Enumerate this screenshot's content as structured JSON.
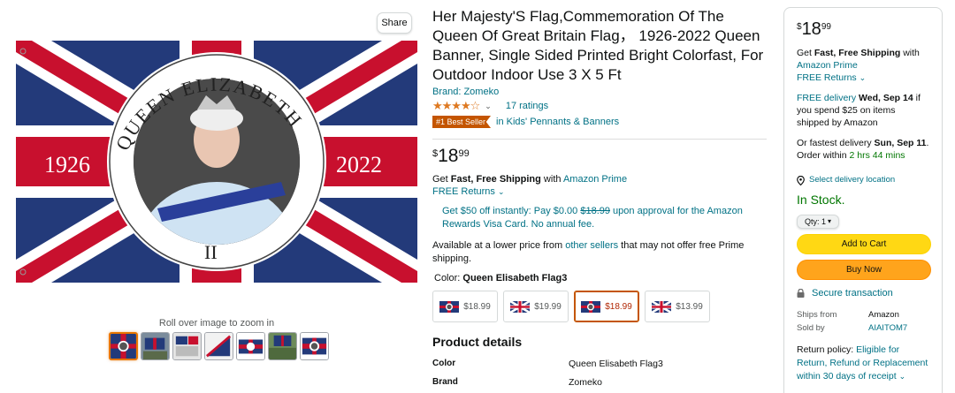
{
  "gallery": {
    "share_label": "Share",
    "zoom_hint": "Roll over image to zoom in",
    "flag_text": {
      "left_year": "1926",
      "right_year": "2022",
      "ring_top": "QUEEN ELIZABETH",
      "ring_bottom": "II"
    },
    "thumbnail_count": 7
  },
  "product": {
    "title": "Her Majesty'S Flag,Commemoration Of The Queen Of Great Britain Flag， 1926-2022 Queen Banner, Single Sided Printed Bright Colorfast, For Outdoor Indoor Use 3 X 5 Ft",
    "brand": "Brand: Zomeko",
    "stars": "★★★★☆",
    "rating_count": "17 ratings",
    "best_seller_badge": "#1 Best Seller",
    "best_seller_category": "in Kids' Pennants & Banners",
    "price": {
      "symbol": "$",
      "whole": "18",
      "fraction": "99"
    },
    "shipping_prefix": "Get ",
    "shipping_bold": "Fast, Free Shipping",
    "shipping_mid": " with ",
    "shipping_link": "Amazon Prime",
    "free_returns": "FREE Returns",
    "promo_pre": "Get $50 off instantly: Pay $0.00 ",
    "promo_strike": "$18.99",
    "promo_post": " upon approval for the Amazon Rewards Visa Card. No annual fee.",
    "lower_price_pre": "Available at a lower price from ",
    "lower_price_link": "other sellers",
    "lower_price_post": " that may not offer free Prime shipping.",
    "color_label": "Color: ",
    "color_value": "Queen Elisabeth Flag3",
    "swatches": [
      {
        "price": "$18.99"
      },
      {
        "price": "$19.99"
      },
      {
        "price": "$18.99"
      },
      {
        "price": "$13.99"
      }
    ],
    "details_title": "Product details",
    "details": [
      {
        "key": "Color",
        "value": "Queen Elisabeth Flag3"
      },
      {
        "key": "Brand",
        "value": "Zomeko"
      }
    ]
  },
  "buybox": {
    "price": {
      "symbol": "$",
      "whole": "18",
      "fraction": "99"
    },
    "shipping_prefix": "Get ",
    "shipping_bold": "Fast, Free Shipping",
    "shipping_mid": " with ",
    "shipping_link": "Amazon Prime",
    "free_returns": "FREE Returns",
    "delivery_link": "FREE delivery",
    "delivery_date": "Wed, Sep 14",
    "delivery_post": " if you spend $25 on items shipped by Amazon",
    "fastest_pre": "Or fastest delivery ",
    "fastest_date": "Sun, Sep 11",
    "fastest_mid": ". Order within ",
    "fastest_time": "2 hrs 44 mins",
    "location": "Select delivery location",
    "stock": "In Stock.",
    "qty": "Qty: 1",
    "add_to_cart": "Add to Cart",
    "buy_now": "Buy Now",
    "secure": "Secure transaction",
    "ships_from_label": "Ships from",
    "ships_from_value": "Amazon",
    "sold_by_label": "Sold by",
    "sold_by_value": "AIAITOM7",
    "return_pre": "Return policy: ",
    "return_link": "Eligible for Return, Refund or Replacement within 30 days of receipt"
  },
  "colors": {
    "link": "#007185",
    "star": "#DE7921",
    "badge": "#C45500",
    "cart": "#FFD814",
    "buy": "#FFA41C",
    "instock": "#007600"
  }
}
